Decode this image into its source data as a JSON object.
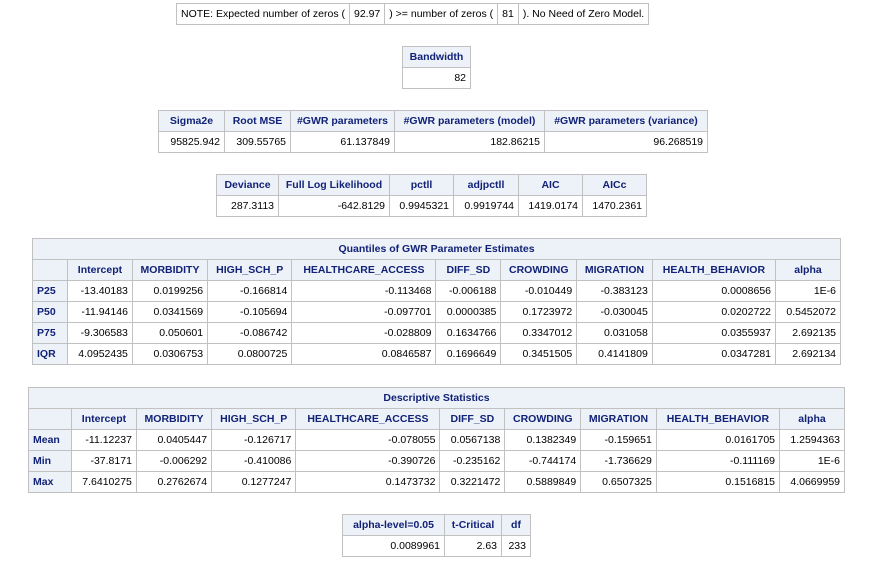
{
  "note": {
    "part1": "NOTE: Expected number of zeros (",
    "expected": "92.97",
    "part2": ") >= number of zeros (",
    "observed": "81",
    "part3": "). No Need of Zero Model."
  },
  "bandwidth": {
    "header": "Bandwidth",
    "value": "82"
  },
  "fit": {
    "headers": [
      "Sigma2e",
      "Root MSE",
      "#GWR parameters",
      "#GWR parameters (model)",
      "#GWR parameters (variance)"
    ],
    "values": [
      "95825.942",
      "309.55765",
      "61.137849",
      "182.86215",
      "96.268519"
    ]
  },
  "likelihood": {
    "headers": [
      "Deviance",
      "Full Log Likelihood",
      "pctll",
      "adjpctll",
      "AIC",
      "AICc"
    ],
    "values": [
      "287.3113",
      "-642.8129",
      "0.9945321",
      "0.9919744",
      "1419.0174",
      "1470.2361"
    ]
  },
  "quantiles": {
    "title": "Quantiles of GWR Parameter Estimates",
    "headers": [
      "Intercept",
      "MORBIDITY",
      "HIGH_SCH_P",
      "HEALTHCARE_ACCESS",
      "DIFF_SD",
      "CROWDING",
      "MIGRATION",
      "HEALTH_BEHAVIOR",
      "alpha"
    ],
    "rows": [
      {
        "label": "P25",
        "cells": [
          "-13.40183",
          "0.0199256",
          "-0.166814",
          "-0.113468",
          "-0.006188",
          "-0.010449",
          "-0.383123",
          "0.0008656",
          "1E-6"
        ]
      },
      {
        "label": "P50",
        "cells": [
          "-11.94146",
          "0.0341569",
          "-0.105694",
          "-0.097701",
          "0.0000385",
          "0.1723972",
          "-0.030045",
          "0.0202722",
          "0.5452072"
        ]
      },
      {
        "label": "P75",
        "cells": [
          "-9.306583",
          "0.050601",
          "-0.086742",
          "-0.028809",
          "0.1634766",
          "0.3347012",
          "0.031058",
          "0.0355937",
          "2.692135"
        ]
      },
      {
        "label": "IQR",
        "cells": [
          "4.0952435",
          "0.0306753",
          "0.0800725",
          "0.0846587",
          "0.1696649",
          "0.3451505",
          "0.4141809",
          "0.0347281",
          "2.692134"
        ]
      }
    ]
  },
  "descriptive": {
    "title": "Descriptive Statistics",
    "headers": [
      "Intercept",
      "MORBIDITY",
      "HIGH_SCH_P",
      "HEALTHCARE_ACCESS",
      "DIFF_SD",
      "CROWDING",
      "MIGRATION",
      "HEALTH_BEHAVIOR",
      "alpha"
    ],
    "rows": [
      {
        "label": "Mean",
        "cells": [
          "-11.12237",
          "0.0405447",
          "-0.126717",
          "-0.078055",
          "0.0567138",
          "0.1382349",
          "-0.159651",
          "0.0161705",
          "1.2594363"
        ]
      },
      {
        "label": "Min",
        "cells": [
          "-37.8171",
          "-0.006292",
          "-0.410086",
          "-0.390726",
          "-0.235162",
          "-0.744174",
          "-1.736629",
          "-0.111169",
          "1E-6"
        ]
      },
      {
        "label": "Max",
        "cells": [
          "7.6410275",
          "0.2762674",
          "0.1277247",
          "0.1473732",
          "0.3221472",
          "0.5889849",
          "0.6507325",
          "0.1516815",
          "4.0669959"
        ]
      }
    ]
  },
  "critical": {
    "headers": [
      "alpha-level=0.05",
      "t-Critical",
      "df"
    ],
    "values": [
      "0.0089961",
      "2.63",
      "233"
    ]
  }
}
